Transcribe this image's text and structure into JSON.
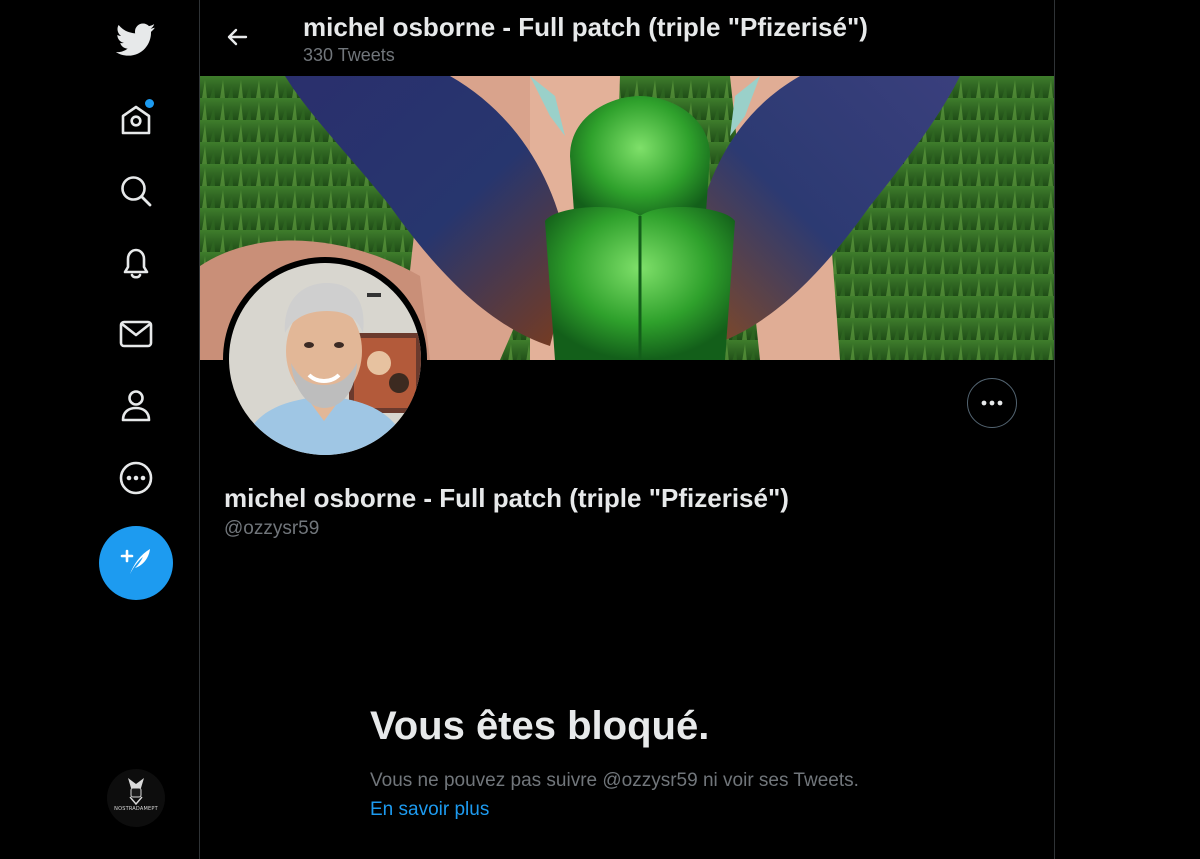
{
  "colors": {
    "background": "#000000",
    "accent": "#1d9bf0",
    "text_primary": "#e7e9ea",
    "text_secondary": "#71767b",
    "border": "#2f3336"
  },
  "nav": {
    "items": [
      {
        "name": "twitter-logo",
        "icon": "bird-icon"
      },
      {
        "name": "home",
        "icon": "home-icon",
        "has_notification": true
      },
      {
        "name": "explore",
        "icon": "search-icon"
      },
      {
        "name": "notifications",
        "icon": "bell-icon"
      },
      {
        "name": "messages",
        "icon": "envelope-icon"
      },
      {
        "name": "profile",
        "icon": "person-icon"
      },
      {
        "name": "more",
        "icon": "more-circle-icon"
      }
    ],
    "compose_icon": "compose-tweet-icon",
    "account_logo_text": "NOSTRADAMEPT"
  },
  "header": {
    "title": "michel osborne - Full patch (triple \"Pfizerisé\")",
    "tweet_count": "330 Tweets",
    "back_icon": "arrow-left-icon"
  },
  "profile": {
    "name": "michel osborne - Full patch (triple \"Pfizerisé\")",
    "handle": "@ozzysr59",
    "more_icon": "ellipsis-icon"
  },
  "blocked": {
    "title": "Vous êtes bloqué.",
    "message": "Vous ne pouvez pas suivre @ozzysr59 ni voir ses Tweets.",
    "link": "En savoir plus"
  }
}
